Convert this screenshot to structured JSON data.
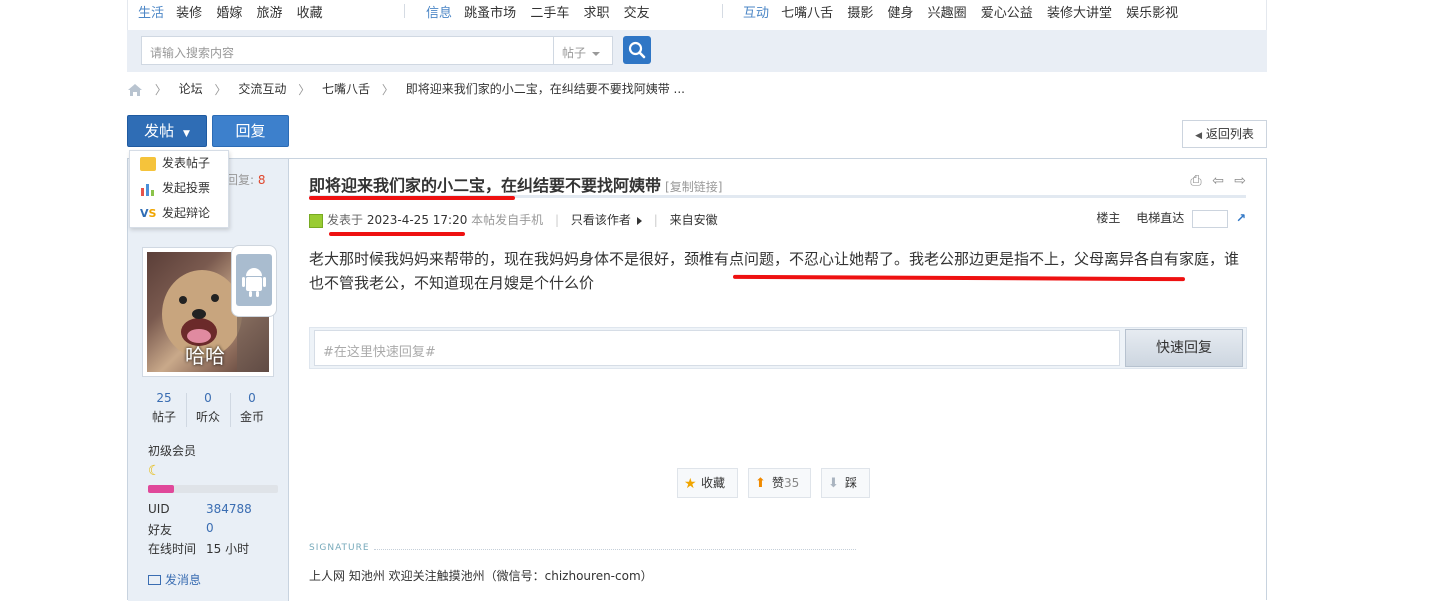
{
  "nav": {
    "groups": [
      {
        "category": "生活",
        "links": [
          "装修",
          "婚嫁",
          "旅游",
          "收藏"
        ]
      },
      {
        "category": "信息",
        "links": [
          "跳蚤市场",
          "二手车",
          "求职",
          "交友"
        ]
      },
      {
        "category": "互动",
        "links": [
          "七嘴八舌",
          "摄影",
          "健身",
          "兴趣圈",
          "爱心公益",
          "装修大讲堂",
          "娱乐影视"
        ]
      }
    ]
  },
  "search": {
    "placeholder": "请输入搜索内容",
    "type": "帖子"
  },
  "breadcrumb": [
    "论坛",
    "交流互动",
    "七嘴八舌",
    "即将迎来我们家的小二宝，在纠结要不要找阿姨带 ..."
  ],
  "buttons": {
    "post": "发帖",
    "reply": "回复",
    "back": "返回列表"
  },
  "dropdown": [
    "发表帖子",
    "发起投票",
    "发起辩论"
  ],
  "sidebar": {
    "reply_label": "回复:",
    "reply_count": "8",
    "avatar_text": "哈哈",
    "stats": [
      {
        "value": "25",
        "label": "帖子"
      },
      {
        "value": "0",
        "label": "听众"
      },
      {
        "value": "0",
        "label": "金币"
      }
    ],
    "level": "初级会员",
    "level_progress": 0.2,
    "uid_label": "UID",
    "uid": "384788",
    "friends_label": "好友",
    "friends": "0",
    "online_label": "在线时间",
    "online": "15 小时",
    "message": "发消息"
  },
  "post": {
    "title": "即将迎来我们家的小二宝，在纠结要不要找阿姨带",
    "copy_link": "[复制链接]",
    "posted_label": "发表于",
    "date": "2023-4-25 17:20",
    "from_mobile": "本帖发自手机",
    "only_author": "只看该作者",
    "location": "来自安徽",
    "floor_label": "楼主",
    "elevator_label": "电梯直达",
    "body": "老大那时候我妈妈来帮带的，现在我妈妈身体不是很好，颈椎有点问题，不忍心让她帮了。我老公那边更是指不上，父母离异各自有家庭，谁也不管我老公，不知道现在月嫂是个什么价"
  },
  "quick_reply": {
    "placeholder": "#在这里快速回复#",
    "button": "快速回复"
  },
  "actions": {
    "favorite": "收藏",
    "like": "赞",
    "like_count": "35",
    "dislike": "踩"
  },
  "signature": {
    "label": "SIGNATURE",
    "text": "上人网 知池州 欢迎关注触摸池州（微信号：chizhouren-com）"
  },
  "colors": {
    "accent": "#2f6db5",
    "highlight": "#ee1111",
    "sidebar_bg": "#e9eff6"
  }
}
